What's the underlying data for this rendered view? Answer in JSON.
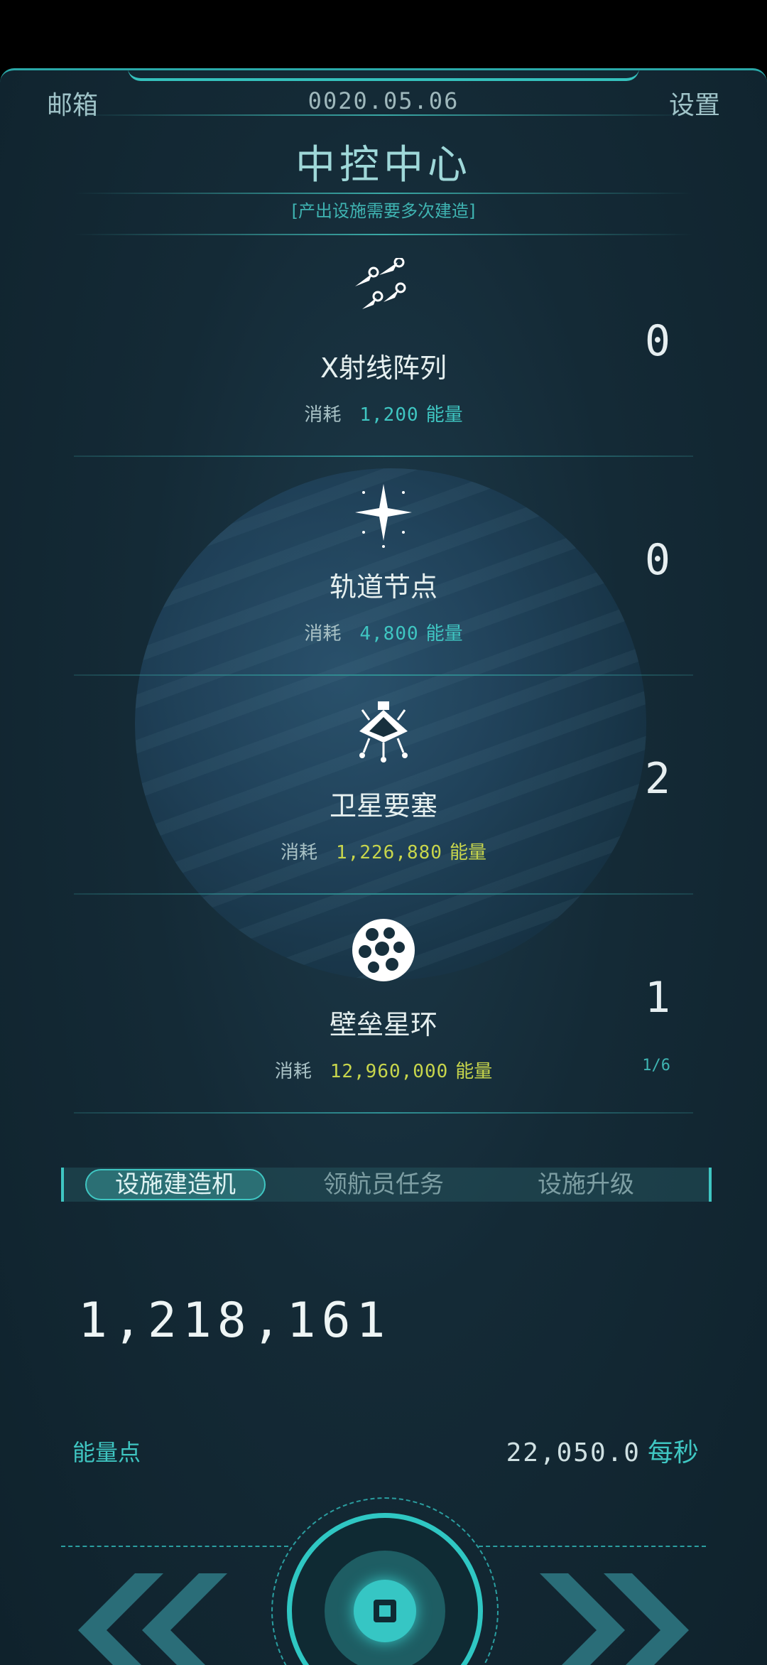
{
  "header": {
    "mail_label": "邮箱",
    "date": "0020.05.06",
    "settings_label": "设置"
  },
  "title": "中控中心",
  "subtitle": "[产出设施需要多次建造]",
  "facilities": [
    {
      "name": "X射线阵列",
      "cost_label": "消耗",
      "cost": "1,200",
      "unit": "能量",
      "count": "0",
      "icon": "xray-array-icon",
      "color": "#3fc6c2"
    },
    {
      "name": "轨道节点",
      "cost_label": "消耗",
      "cost": "4,800",
      "unit": "能量",
      "count": "0",
      "icon": "orbit-node-icon",
      "color": "#3fc6c2"
    },
    {
      "name": "卫星要塞",
      "cost_label": "消耗",
      "cost": "1,226,880",
      "unit": "能量",
      "count": "2",
      "icon": "satellite-fortress-icon",
      "color": "#c8d64c"
    },
    {
      "name": "壁垒星环",
      "cost_label": "消耗",
      "cost": "12,960,000",
      "unit": "能量",
      "count": "1",
      "progress": "1/6",
      "icon": "bastion-ring-icon",
      "color": "#c8d64c"
    }
  ],
  "tabs": [
    {
      "label": "设施建造机",
      "active": true
    },
    {
      "label": "领航员任务",
      "active": false
    },
    {
      "label": "设施升级",
      "active": false
    }
  ],
  "energy": {
    "value": "1,218,161",
    "label": "能量点",
    "rate": "22,050.0",
    "rate_unit": "每秒"
  }
}
